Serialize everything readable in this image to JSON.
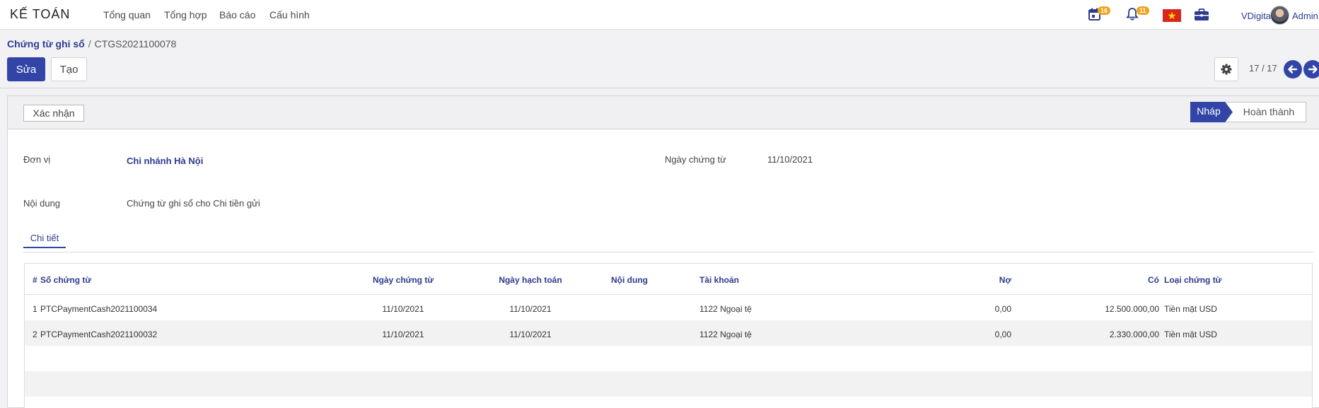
{
  "navbar": {
    "brand": "KẾ TOÁN",
    "menu": [
      "Tổng quan",
      "Tổng hợp",
      "Báo cáo",
      "Cấu hình"
    ],
    "calendar_badge": "16",
    "notification_badge": "11",
    "company": "VDigital",
    "user": "Admin",
    "flag_color": "#da251d"
  },
  "breadcrumb": {
    "parent": "Chứng từ ghi sổ",
    "separator": "/",
    "current": "CTGS2021100078"
  },
  "actions": {
    "edit_label": "Sửa",
    "create_label": "Tạo"
  },
  "pager": {
    "value": "17 / 17"
  },
  "statusbar": {
    "confirm_label": "Xác nhận",
    "stages": [
      "Nháp",
      "Hoàn thành"
    ],
    "active_stage": "Nháp"
  },
  "form": {
    "unit_label": "Đơn vị",
    "unit_value": "Chi nhánh Hà Nội",
    "date_label": "Ngày chứng từ",
    "date_value": "11/10/2021",
    "content_label": "Nội dung",
    "content_value": "Chứng từ ghi sổ cho Chi tiền gửi"
  },
  "tabs": {
    "detail": "Chi tiết"
  },
  "table": {
    "headers": {
      "index": "#",
      "doc_no": "Số chứng từ",
      "doc_date": "Ngày chứng từ",
      "post_date": "Ngày hạch toán",
      "content": "Nội dung",
      "account": "Tài khoản",
      "debit": "Nợ",
      "credit": "Có",
      "doc_type": "Loại chứng từ"
    },
    "rows": [
      {
        "index": "1",
        "doc_no": "PTCPaymentCash2021100034",
        "doc_date": "11/10/2021",
        "post_date": "11/10/2021",
        "content": "",
        "account": "1122 Ngoại tệ",
        "debit": "0,00",
        "credit": "12.500.000,00",
        "doc_type": "Tiền mặt USD"
      },
      {
        "index": "2",
        "doc_no": "PTCPaymentCash2021100032",
        "doc_date": "11/10/2021",
        "post_date": "11/10/2021",
        "content": "",
        "account": "1122 Ngoại tệ",
        "debit": "0,00",
        "credit": "2.330.000,00",
        "doc_type": "Tiền mặt USD"
      }
    ]
  },
  "colors": {
    "primary": "#3245a7",
    "link": "#2e3b8f",
    "badge": "#f0a31c"
  }
}
